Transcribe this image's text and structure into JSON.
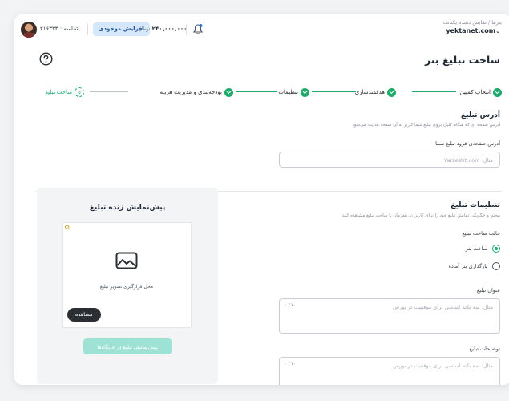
{
  "header": {
    "breadcrumb": "بنرها / نمایش دهنده یکتانت",
    "site": "yektanet.com",
    "account_id": "شناسه : ۲۱۶۳۳۴",
    "topup_label": "افزایش موجودی",
    "balance_amount": "۲۴۰,۰۰۰,۰۰۰",
    "balance_currency": "تومان"
  },
  "page": {
    "title": "ساخت تبلیغ بنر",
    "help_icon": "question-circle-icon"
  },
  "stepper": {
    "steps": [
      {
        "label": "انتخاب کمپین",
        "state": "done"
      },
      {
        "label": "هدفمندسازی",
        "state": "done"
      },
      {
        "label": "تنظیمات",
        "state": "done"
      },
      {
        "label": "بودجه‌بندی و مدیریت هزینه",
        "state": "done"
      },
      {
        "label": "ساخت تبلیغ",
        "state": "active",
        "number": "۵"
      }
    ],
    "accent": "#1faa6b"
  },
  "address": {
    "title": "آدرس تبلیغ",
    "description": "آدرس صفحه ای که هنگام کلیک بروی تبلیغ شما کاربر به آن صفحه هدایت می‌شود",
    "field_label": "آدرس صفحه‌ی فرود تبلیغ شما",
    "placeholder": "مثال: Varzesh۳.com"
  },
  "settings": {
    "title": "تنظیمات تبلیغ",
    "description": "محتوا و چگونگی نمایش تبلیغ خود را برای کاربران، همزمان با ساخت تبلیغ مشاهده کنید",
    "mode_label": "حالت ساخت تبلیغ",
    "options": [
      {
        "label": "ساخت بنر",
        "selected": true
      },
      {
        "label": "بارگذاری بنر آماده",
        "selected": false
      }
    ],
    "title_field": {
      "label": "عنوان تبلیغ",
      "placeholder": "مثال: سه نکته اساسی برای موفقیت در بورس",
      "counter": "۰ / ۷۰"
    },
    "desc_field": {
      "label": "توضیحات تبلیغ",
      "placeholder": "مثال: سه نکته اساسی برای موفقیت در بورس",
      "counter": "۰ / ۷۰"
    }
  },
  "preview": {
    "title": "پیش‌نمایش زنده تبلیغ",
    "image_caption": "محل قرارگیری تصویر تبلیغ",
    "view_label": "مشاهده",
    "placements_label": "پیش‌نمایش تبلیغ در جایگاه‌ها"
  }
}
